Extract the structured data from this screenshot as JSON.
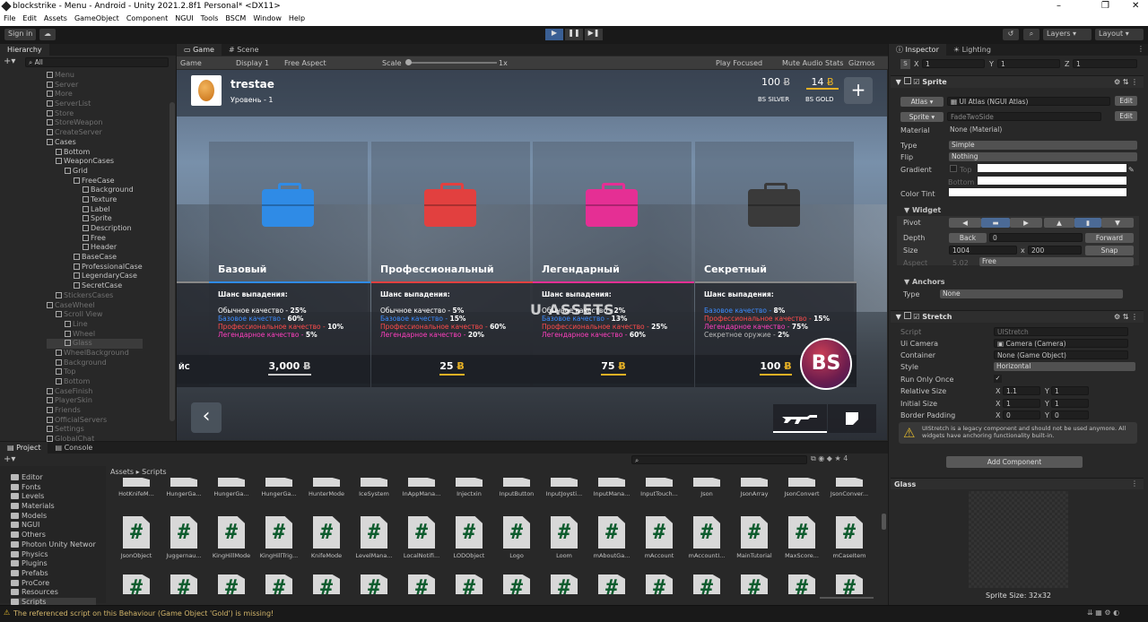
{
  "window": {
    "title": "blockstrike - Menu - Android - Unity 2021.2.8f1 Personal* <DX11>"
  },
  "menu": [
    "File",
    "Edit",
    "Assets",
    "GameObject",
    "Component",
    "NGUI",
    "Tools",
    "BSCM",
    "Window",
    "Help"
  ],
  "toolbar": {
    "sign_in": "Sign in",
    "layers": "Layers",
    "layout": "Layout"
  },
  "hierarchy": {
    "tab": "Hierarchy",
    "search": "All",
    "items": [
      {
        "label": "Menu",
        "depth": 0,
        "dim": true
      },
      {
        "label": "Server",
        "depth": 0,
        "dim": true
      },
      {
        "label": "More",
        "depth": 0,
        "dim": true
      },
      {
        "label": "ServerList",
        "depth": 0,
        "dim": true
      },
      {
        "label": "Store",
        "depth": 0,
        "dim": true
      },
      {
        "label": "StoreWeapon",
        "depth": 0,
        "dim": true
      },
      {
        "label": "CreateServer",
        "depth": 0,
        "dim": true
      },
      {
        "label": "Cases",
        "depth": 0,
        "dim": false
      },
      {
        "label": "Bottom",
        "depth": 1,
        "dim": false
      },
      {
        "label": "WeaponCases",
        "depth": 1,
        "dim": false
      },
      {
        "label": "Grid",
        "depth": 2,
        "dim": false
      },
      {
        "label": "FreeCase",
        "depth": 3,
        "dim": false
      },
      {
        "label": "Background",
        "depth": 4,
        "dim": false
      },
      {
        "label": "Texture",
        "depth": 4,
        "dim": false
      },
      {
        "label": "Label",
        "depth": 4,
        "dim": false
      },
      {
        "label": "Sprite",
        "depth": 4,
        "dim": false
      },
      {
        "label": "Description",
        "depth": 4,
        "dim": false
      },
      {
        "label": "Free",
        "depth": 4,
        "dim": false
      },
      {
        "label": "Header",
        "depth": 4,
        "dim": false
      },
      {
        "label": "BaseCase",
        "depth": 3,
        "dim": false
      },
      {
        "label": "ProfessionalCase",
        "depth": 3,
        "dim": false
      },
      {
        "label": "LegendaryCase",
        "depth": 3,
        "dim": false
      },
      {
        "label": "SecretCase",
        "depth": 3,
        "dim": false
      },
      {
        "label": "StickersCases",
        "depth": 1,
        "dim": true
      },
      {
        "label": "CaseWheel",
        "depth": 0,
        "dim": true
      },
      {
        "label": "Scroll View",
        "depth": 1,
        "dim": true
      },
      {
        "label": "Line",
        "depth": 2,
        "dim": true
      },
      {
        "label": "Wheel",
        "depth": 2,
        "dim": true
      },
      {
        "label": "Glass",
        "depth": 2,
        "dim": true
      },
      {
        "label": "WheelBackground",
        "depth": 1,
        "dim": true
      },
      {
        "label": "Background",
        "depth": 1,
        "dim": true
      },
      {
        "label": "Top",
        "depth": 1,
        "dim": true
      },
      {
        "label": "Bottom",
        "depth": 1,
        "dim": true
      },
      {
        "label": "CaseFinish",
        "depth": 0,
        "dim": true
      },
      {
        "label": "PlayerSkin",
        "depth": 0,
        "dim": true
      },
      {
        "label": "Friends",
        "depth": 0,
        "dim": true
      },
      {
        "label": "OfficialServers",
        "depth": 0,
        "dim": true
      },
      {
        "label": "Settings",
        "depth": 0,
        "dim": true
      },
      {
        "label": "GlobalChat",
        "depth": 0,
        "dim": true
      }
    ]
  },
  "game_tabs": {
    "game": "Game",
    "scene": "Scene"
  },
  "game_bar": {
    "mode": "Game",
    "display": "Display 1",
    "aspect": "Free Aspect",
    "scale_label": "Scale",
    "scale_value": "1x",
    "play_focused": "Play Focused",
    "mute": "Mute Audio",
    "stats": "Stats",
    "gizmos": "Gizmos"
  },
  "game": {
    "player": "trestae",
    "level": "Уровень - 1",
    "silver_value": "100",
    "silver_label": "BS SILVER",
    "gold_value": "14",
    "gold_label": "BS GOLD",
    "plus": "+",
    "back": "‹",
    "bs_logo": "BS",
    "watermark": "U ASSETS",
    "left_stub": "ЙС",
    "chance_header": "Шанс выпадения:",
    "cards": [
      {
        "title": "Базовый",
        "color": "#2f8be6",
        "lines": [
          {
            "t": "Обычное качество - ",
            "v": "25%",
            "c": "#ffffff"
          },
          {
            "t": "Базовое качество - ",
            "v": "60%",
            "c": "#3d8cff"
          },
          {
            "t": "Профессиональное качество - ",
            "v": "10%",
            "c": "#ff4b4b"
          },
          {
            "t": "Легендарное качество - ",
            "v": "5%",
            "c": "#ff3fbf"
          }
        ],
        "price": "3,000",
        "currency": "Ƀ",
        "price_color": "#c9c9c9"
      },
      {
        "title": "Профессиональный",
        "color": "#e2403f",
        "lines": [
          {
            "t": "Обычное качество - ",
            "v": "5%",
            "c": "#ffffff"
          },
          {
            "t": "Базовое качество - ",
            "v": "15%",
            "c": "#3d8cff"
          },
          {
            "t": "Профессиональное качество - ",
            "v": "60%",
            "c": "#ff4b4b"
          },
          {
            "t": "Легендарное качество - ",
            "v": "20%",
            "c": "#ff3fbf"
          }
        ],
        "price": "25",
        "currency": "Ƀ",
        "price_color": "#e7b125"
      },
      {
        "title": "Легендарный",
        "color": "#e52f94",
        "lines": [
          {
            "t": "Обычное качество - ",
            "v": "2%",
            "c": "#ffffff"
          },
          {
            "t": "Базовое качество - ",
            "v": "13%",
            "c": "#3d8cff"
          },
          {
            "t": "Профессиональное качество - ",
            "v": "25%",
            "c": "#ff4b4b"
          },
          {
            "t": "Легендарное качество - ",
            "v": "60%",
            "c": "#ff3fbf"
          }
        ],
        "price": "75",
        "currency": "Ƀ",
        "price_color": "#e7b125"
      },
      {
        "title": "Секретный",
        "color": "#3a3a3a",
        "lines": [
          {
            "t": "Базовое качество - ",
            "v": "8%",
            "c": "#3d8cff"
          },
          {
            "t": "Профессиональное качество - ",
            "v": "15%",
            "c": "#ff4b4b"
          },
          {
            "t": "Легендарное качество - ",
            "v": "75%",
            "c": "#ff3fbf"
          },
          {
            "t": "Секретное оружие - ",
            "v": "2%",
            "c": "#bbbbbb"
          }
        ],
        "price": "100",
        "currency": "Ƀ",
        "price_color": "#e7b125"
      }
    ]
  },
  "project": {
    "tab": "Project",
    "console": "Console",
    "breadcrumb_root": "Assets",
    "breadcrumb_leaf": "Scripts",
    "count": "4",
    "folders": [
      "Editor",
      "Fonts",
      "Levels",
      "Materials",
      "Models",
      "NGUI",
      "Others",
      "Photon Unity Networ",
      "Physics",
      "Plugins",
      "Prefabs",
      "ProCore",
      "Resources",
      "Scripts"
    ],
    "row1": [
      "HotKnifeM...",
      "HungerGa...",
      "HungerGa...",
      "HungerGa...",
      "HunterMode",
      "IceSystem",
      "InAppMana...",
      "Injectxin",
      "InputButton",
      "InputJoysti...",
      "InputMana...",
      "InputTouch...",
      "Json",
      "JsonArray",
      "JsonConvert",
      "JsonConver..."
    ],
    "row2": [
      "JsonObject",
      "Juggernau...",
      "KingHillMode",
      "KingHillTrig...",
      "KnifeMode",
      "LevelMana...",
      "LocalNotifi...",
      "LODObject",
      "Logo",
      "Loom",
      "mAboutGa...",
      "mAccount",
      "mAccountI...",
      "MainTutorial",
      "MaxScore...",
      "mCaseItem"
    ]
  },
  "inspector": {
    "tab": "Inspector",
    "lighting": "Lighting",
    "s": "S",
    "x_label": "X",
    "x_val": "1",
    "y_label": "Y",
    "y_val": "1",
    "z_label": "Z",
    "z_val": "1",
    "sprite_comp": "Sprite",
    "atlas_label": "Atlas",
    "atlas_val": "UI Atlas (NGUI Atlas)",
    "edit": "Edit",
    "sprite_label": "Sprite",
    "sprite_val": "FadeTwoSide",
    "material_label": "Material",
    "material_val": "None (Material)",
    "type_label": "Type",
    "type_val": "Simple",
    "flip_label": "Flip",
    "flip_val": "Nothing",
    "gradient_label": "Gradient",
    "top_label": "Top",
    "bottom_label": "Bottom",
    "tint_label": "Color Tint",
    "widget": "Widget",
    "pivot_label": "Pivot",
    "depth_label": "Depth",
    "back": "Back",
    "depth_val": "0",
    "forward": "Forward",
    "size_label": "Size",
    "size_w": "1004",
    "size_x": "x",
    "size_h": "200",
    "snap": "Snap",
    "aspect_label": "Aspect",
    "aspect_ratio": "5.02",
    "aspect_val": "Free",
    "anchors": "Anchors",
    "anchor_type_label": "Type",
    "anchor_type_val": "None",
    "stretch": "Stretch",
    "script_label": "Script",
    "script_val": "UIStretch",
    "cam_label": "Ui Camera",
    "cam_val": "Camera (Camera)",
    "container_label": "Container",
    "container_val": "None (Game Object)",
    "style_label": "Style",
    "style_val": "Horizontal",
    "run_once_label": "Run Only Once",
    "check": "✓",
    "rel_label": "Relative Size",
    "rel_x": "1.1",
    "rel_y": "1",
    "init_label": "Initial Size",
    "init_x": "1",
    "init_y": "1",
    "pad_label": "Border Padding",
    "pad_x": "0",
    "pad_y": "0",
    "warning": "UIStretch is a legacy component and should not be used anymore. All widgets have anchoring functionality built-in.",
    "add_component": "Add Component",
    "glass": "Glass",
    "sprite_size": "Sprite Size: 32x32"
  },
  "status": {
    "message": "The referenced script on this Behaviour (Game Object 'Gold') is missing!"
  }
}
